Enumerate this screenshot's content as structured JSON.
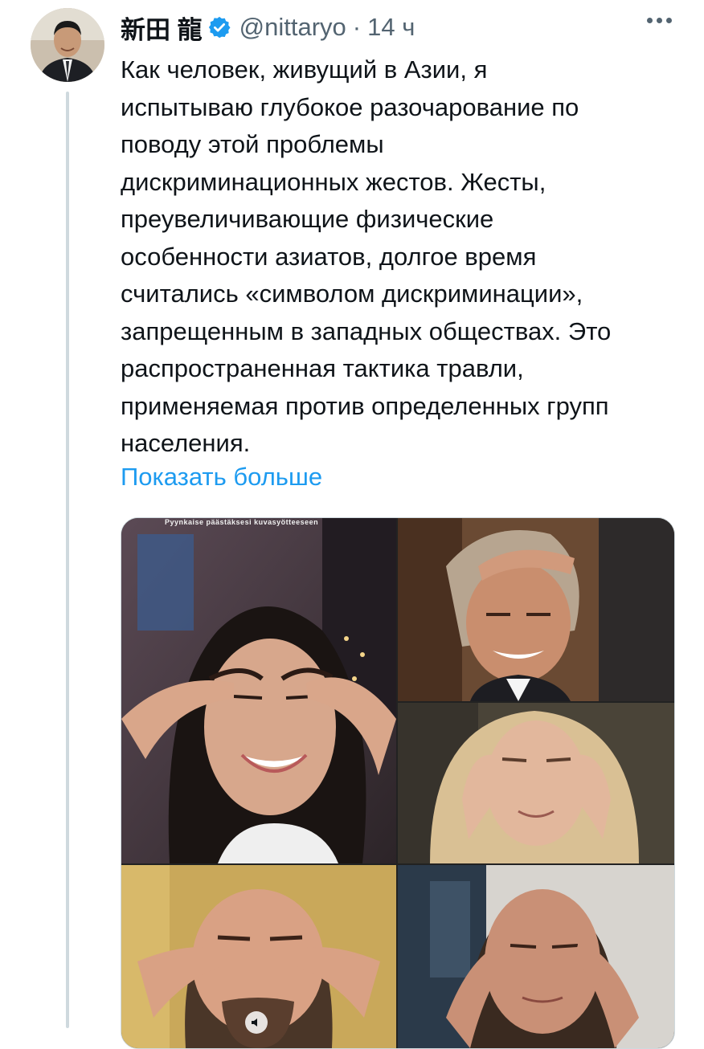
{
  "author": {
    "name": "新田 龍",
    "handle": "@nittaryo",
    "separator": "·",
    "time": "14 ч",
    "verified": true,
    "avatar_icon": "avatar-photo"
  },
  "tweet": {
    "text": "Как человек, живущий в Азии, я\nиспытываю глубокое разочарование по\nповоду этой проблемы\nдискриминационных жестов. Жесты,\nпреувеличивающие физические\nособенности азиатов, долгое время\nсчитались «символом дискриминации»,\nзапрещенным в западных обществах. Это\nраспространенная тактика травли,\nприменяемая против определенных групп\nнаселения.",
    "show_more": "Показать больше"
  },
  "media": {
    "watermark": "Pyynkaise päästäksesi kuvasyötteeseen",
    "tiles": [
      "video-tile-woman-dark-hair",
      "video-tile-man-grey-hair",
      "video-tile-woman-blonde",
      "video-tile-man-beard",
      "video-tile-man-short-hair"
    ],
    "sound_icon": "speaker-icon"
  },
  "colors": {
    "link": "#1d9bf0",
    "verified": "#1d9bf0",
    "secondary_text": "#536471",
    "thread_line": "#cfd9de"
  }
}
